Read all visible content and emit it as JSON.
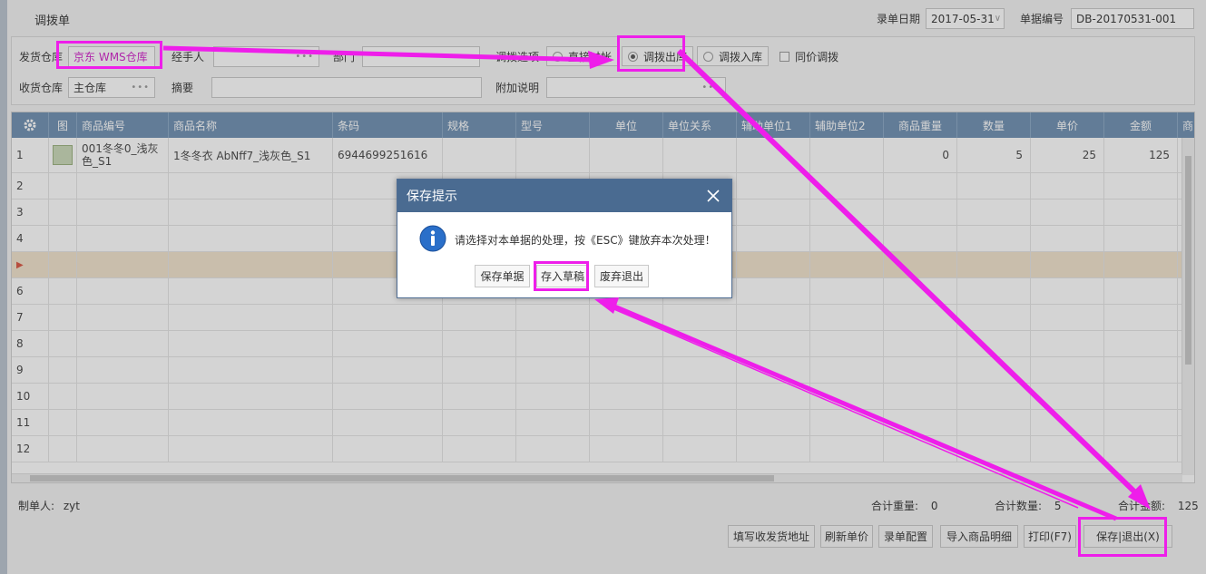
{
  "page": {
    "title": "调拨单",
    "date_label": "录单日期",
    "date_value": "2017-05-31",
    "doc_no_label": "单据编号",
    "doc_no_value": "DB-20170531-001"
  },
  "form": {
    "ship_warehouse_label": "发货仓库",
    "ship_warehouse_value": "京东 WMS仓库",
    "handler_label": "经手人",
    "dept_label": "部门",
    "transfer_type_label": "调拨选项",
    "options": [
      "直接过帐",
      "调拨出库",
      "调拨入库"
    ],
    "selected_option": "调拨出库",
    "same_price_label": "同价调拨",
    "recv_warehouse_label": "收货仓库",
    "recv_warehouse_value": "主仓库",
    "summary_label": "摘要",
    "extra_note_label": "附加说明"
  },
  "grid": {
    "columns": [
      "图",
      "商品编号",
      "商品名称",
      "条码",
      "规格",
      "型号",
      "单位",
      "单位关系",
      "辅助单位1",
      "辅助单位2",
      "商品重量",
      "数量",
      "单价",
      "金额",
      "商"
    ],
    "rows": [
      {
        "no": "1",
        "code_line1": "001冬冬0_浅灰",
        "code_line2": "色_S1",
        "name": "1冬冬衣 AbNff7_浅灰色_S1",
        "barcode": "6944699251616",
        "weight": "0",
        "qty": "5",
        "price": "25",
        "amount": "125"
      },
      {
        "no": "2"
      },
      {
        "no": "3"
      },
      {
        "no": "4"
      },
      {
        "no": "▶"
      },
      {
        "no": "6"
      },
      {
        "no": "7"
      },
      {
        "no": "8"
      },
      {
        "no": "9"
      },
      {
        "no": "10"
      },
      {
        "no": "11"
      },
      {
        "no": "12"
      }
    ]
  },
  "footer": {
    "creator_label": "制单人:",
    "creator_value": "zyt",
    "total_weight_label": "合计重量:",
    "total_weight_value": "0",
    "total_qty_label": "合计数量:",
    "total_qty_value": "5",
    "total_amount_label": "合计金额:",
    "total_amount_value": "125"
  },
  "buttons": {
    "fill_address": "填写收发货地址",
    "refresh_price": "刷新单价",
    "entry_config": "录单配置",
    "import_detail": "导入商品明细",
    "print": "打印(F7)",
    "save_exit": "保存|退出(X)"
  },
  "dialog": {
    "title": "保存提示",
    "message": "请选择对本单据的处理，按《ESC》键放弃本次处理！",
    "save_doc": "保存单据",
    "save_draft": "存入草稿",
    "discard_exit": "废弃退出"
  },
  "colors": {
    "grid_header": "#6d8fb1",
    "dialog_title": "#4a6b91",
    "highlight": "#ee1eea"
  }
}
